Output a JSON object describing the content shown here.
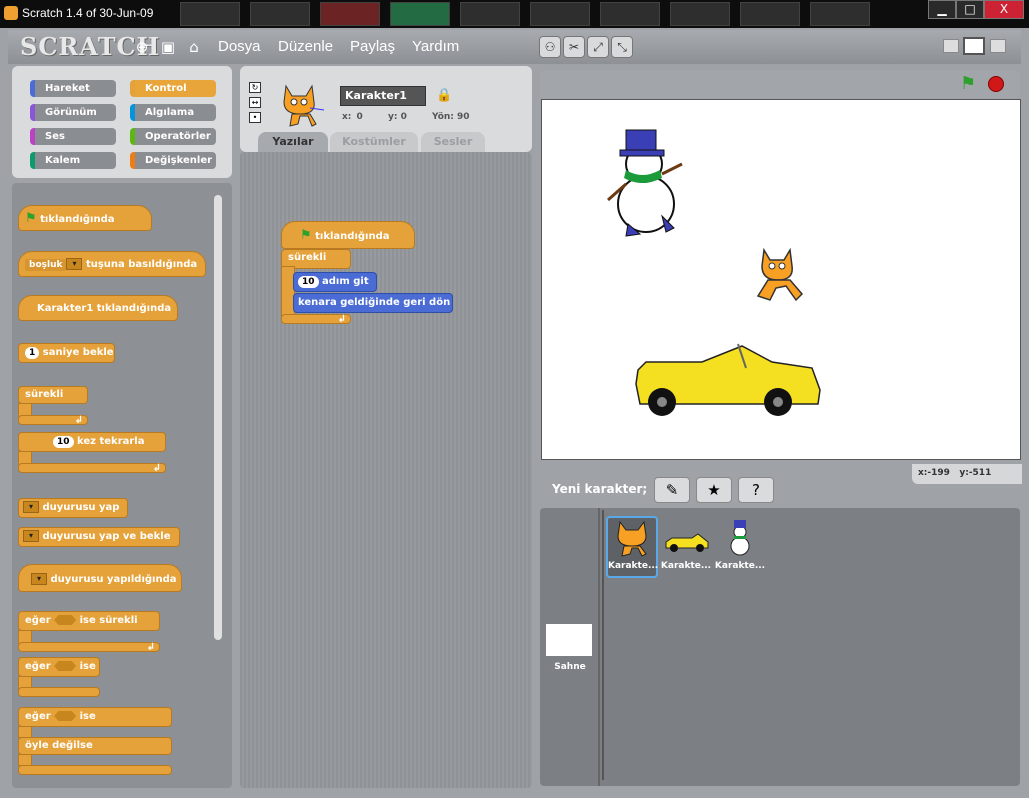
{
  "window": {
    "title": "Scratch 1.4 of 30-Jun-09",
    "min": "▁",
    "max": "□",
    "close": "X"
  },
  "logo": "SCRATCH",
  "menu": [
    "Dosya",
    "Düzenle",
    "Paylaş",
    "Yardım"
  ],
  "categories": [
    {
      "label": "Hareket",
      "color": "#4a6cd4"
    },
    {
      "label": "Kontrol",
      "color": "#e6a23a",
      "selected": true
    },
    {
      "label": "Görünüm",
      "color": "#8a55d7"
    },
    {
      "label": "Algılama",
      "color": "#0494dc"
    },
    {
      "label": "Ses",
      "color": "#bb42c3"
    },
    {
      "label": "Operatörler",
      "color": "#5cb712"
    },
    {
      "label": "Kalem",
      "color": "#0e9a6c"
    },
    {
      "label": "Değişkenler",
      "color": "#ee7d16"
    }
  ],
  "palette": {
    "flag_clicked": "tıklandığında",
    "key_slot": "boşluk",
    "key_pressed": "tuşuna basıldığında",
    "sprite_clicked": "Karakter1 tıklandığında",
    "wait_num": "1",
    "wait_label": "saniye bekle",
    "forever": "sürekli",
    "repeat_num": "10",
    "repeat_label": "kez tekrarla",
    "broadcast": "duyurusu yap",
    "broadcast_wait": "duyurusu yap ve bekle",
    "when_receive": "duyurusu yapıldığında",
    "if_label": "eğer",
    "forever_if": "ise sürekli",
    "if_then": "ise",
    "else_label": "öyle değilse"
  },
  "sprite": {
    "name": "Karakter1",
    "x_label": "x:",
    "x": "0",
    "y_label": "y:",
    "y": "0",
    "dir_label": "Yön:",
    "dir": "90"
  },
  "tabs": [
    "Yazılar",
    "Kostümler",
    "Sesler"
  ],
  "script": {
    "hat": "tıklandığında",
    "forever": "sürekli",
    "move_num": "10",
    "move": "adım git",
    "bounce": "kenara geldiğinde geri dön"
  },
  "stage": {
    "mouse_x_label": "x:",
    "mouse_x": "-199",
    "mouse_y_label": "y:",
    "mouse_y": "-511"
  },
  "new_sprite": "Yeni karakter;",
  "sprites": [
    "Karakte...",
    "Karakte...",
    "Karakte..."
  ],
  "stage_label": "Sahne"
}
